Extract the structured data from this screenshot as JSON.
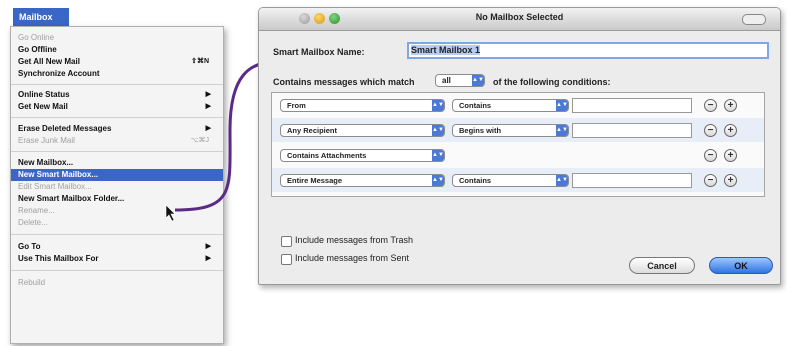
{
  "menu": {
    "title": "Mailbox",
    "items": [
      {
        "label": "Go Online",
        "disabled": true
      },
      {
        "label": "Go Offline"
      },
      {
        "label": "Get All New Mail",
        "shortcut": "⇧⌘N"
      },
      {
        "label": "Synchronize Account"
      },
      {
        "label": "Online Status",
        "submenu": true
      },
      {
        "label": "Get New Mail",
        "submenu": true
      },
      {
        "label": "Erase Deleted Messages",
        "submenu": true
      },
      {
        "label": "Erase Junk Mail",
        "disabled": true,
        "shortcut": "⌥⌘J"
      },
      {
        "label": "New Mailbox..."
      },
      {
        "label": "New Smart Mailbox...",
        "highlighted": true
      },
      {
        "label": "Edit Smart Mailbox...",
        "disabled": true
      },
      {
        "label": "New Smart Mailbox Folder..."
      },
      {
        "label": "Rename...",
        "disabled": true
      },
      {
        "label": "Delete...",
        "disabled": true
      },
      {
        "label": "Go To",
        "submenu": true
      },
      {
        "label": "Use This Mailbox For",
        "submenu": true
      },
      {
        "label": "Rebuild",
        "disabled": true
      }
    ],
    "submenu_arrow": "▶"
  },
  "dialog": {
    "title": "No Mailbox Selected",
    "name_label": "Smart Mailbox Name:",
    "name_value": "Smart Mailbox 1",
    "match_prefix": "Contains messages which match",
    "match_value": "all",
    "match_suffix": "of the following conditions:",
    "conditions": [
      {
        "field": "From",
        "operator": "Contains",
        "value": ""
      },
      {
        "field": "Any Recipient",
        "operator": "Begins with",
        "value": ""
      },
      {
        "field": "Contains Attachments",
        "operator": "",
        "value": ""
      },
      {
        "field": "Entire Message",
        "operator": "Contains",
        "value": ""
      }
    ],
    "remove_symbol": "−",
    "add_symbol": "+",
    "include_trash": "Include messages from Trash",
    "include_sent": "Include messages from Sent",
    "cancel": "Cancel",
    "ok": "OK",
    "popup_arrows": "▲▼"
  },
  "colors": {
    "accent": "#3a67c6",
    "arrow": "#5b2a86"
  }
}
